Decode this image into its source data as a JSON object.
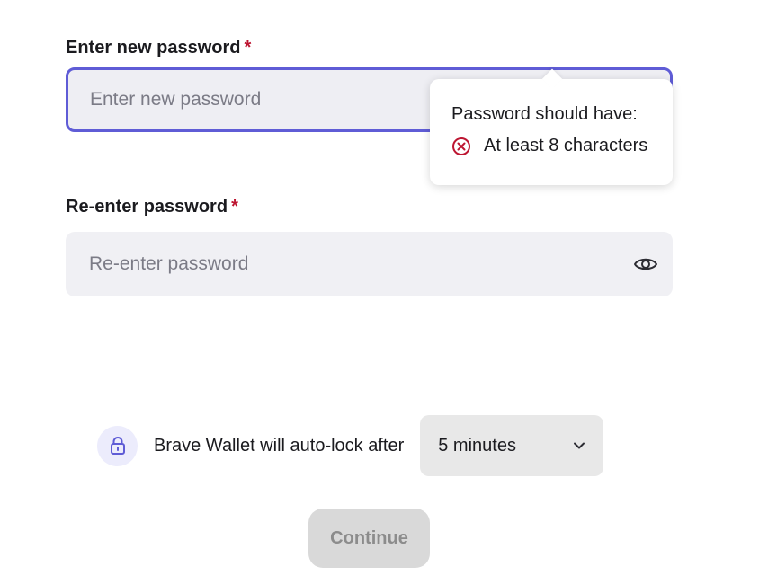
{
  "new_password": {
    "label": "Enter new password",
    "required_mark": "*",
    "placeholder": "Enter new password",
    "value": ""
  },
  "tooltip": {
    "title": "Password should have:",
    "rules": [
      {
        "text": "At least 8 characters",
        "status": "unmet"
      }
    ]
  },
  "confirm_password": {
    "label": "Re-enter password",
    "required_mark": "*",
    "placeholder": "Re-enter password",
    "value": ""
  },
  "autolock": {
    "text": "Brave Wallet will auto-lock after",
    "selected": "5 minutes"
  },
  "continue_label": "Continue",
  "icons": {
    "eye": "eye-icon",
    "error": "x-circle-icon",
    "lock": "lock-icon",
    "chevron": "chevron-down-icon"
  },
  "colors": {
    "focus_border": "#5f5cd6",
    "required": "#bd1531",
    "error": "#bd1531",
    "lock_accent": "#5f5cd6"
  }
}
